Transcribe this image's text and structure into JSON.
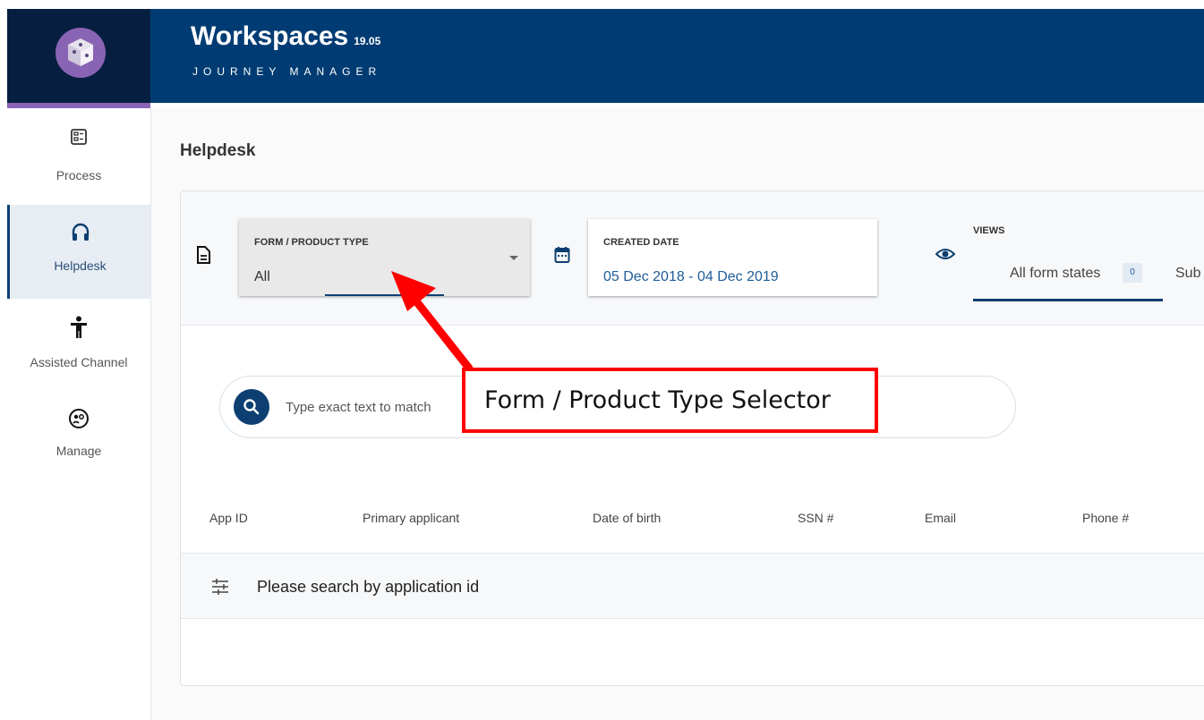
{
  "header": {
    "title": "Workspaces",
    "version": "19.05",
    "subtitle": "JOURNEY MANAGER",
    "logo_icon": "cube-logo-icon",
    "background": "#003c73",
    "logo_background": "#061f40",
    "accent": "#8a64b4"
  },
  "sidebar": {
    "items": [
      {
        "label": "Process",
        "icon": "process-icon",
        "active": false
      },
      {
        "label": "Helpdesk",
        "icon": "headset-icon",
        "active": true
      },
      {
        "label": "Assisted Channel",
        "icon": "accessibility-icon",
        "active": false
      },
      {
        "label": "Manage",
        "icon": "manage-icon",
        "active": false
      }
    ]
  },
  "page": {
    "title": "Helpdesk"
  },
  "filters": {
    "form_type": {
      "label": "FORM / PRODUCT TYPE",
      "value": "All",
      "icon": "document-icon"
    },
    "created_date": {
      "label": "CREATED DATE",
      "value": "05 Dec 2018 - 04 Dec 2019",
      "icon": "calendar-icon"
    },
    "views": {
      "label": "VIEWS",
      "icon": "eye-icon",
      "tabs": [
        {
          "label": "All form states",
          "count": "0",
          "active": true
        },
        {
          "label": "Sub",
          "active": false
        }
      ]
    }
  },
  "search": {
    "placeholder": "Type exact text to match",
    "icon": "search-icon"
  },
  "table": {
    "columns": [
      "App ID",
      "Primary applicant",
      "Date of birth",
      "SSN #",
      "Email",
      "Phone #"
    ],
    "empty_message": "Please search by application id",
    "empty_icon": "filter-sliders-icon"
  },
  "annotation": {
    "text": "Form / Product Type Selector",
    "color": "#ff0000"
  }
}
